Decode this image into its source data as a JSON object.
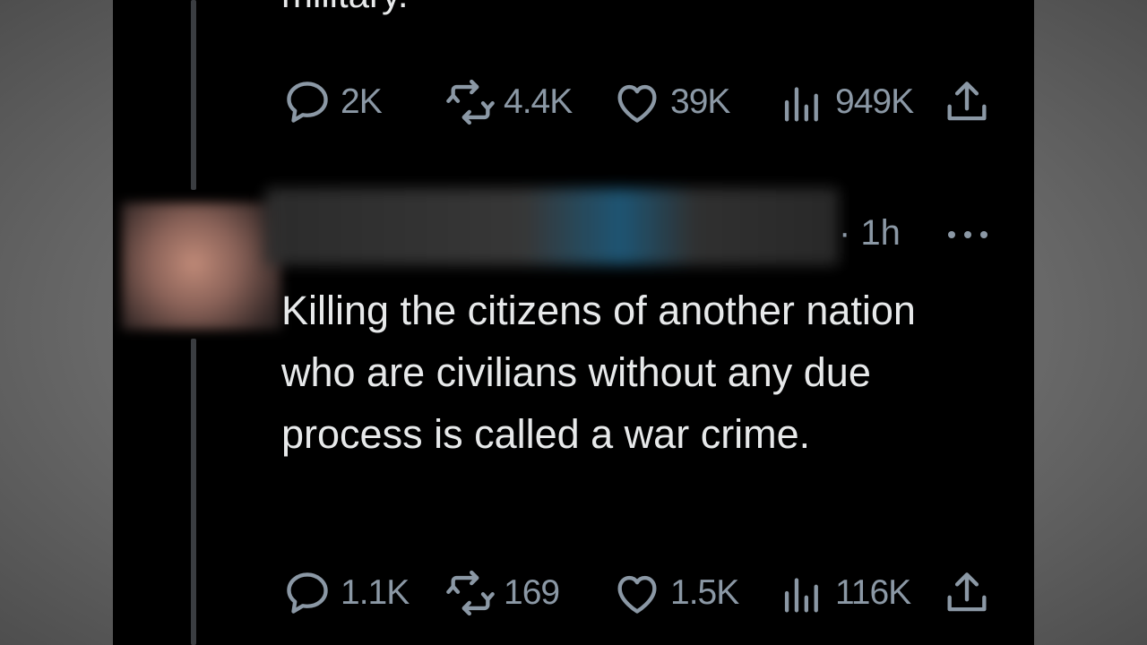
{
  "previous_tweet": {
    "text_fragment": "military.",
    "stats": {
      "replies": "2K",
      "retweets": "4.4K",
      "likes": "39K",
      "views": "949K"
    }
  },
  "reply_tweet": {
    "time": "· 1h",
    "text": "Killing the citizens of another nation who are civilians without any due process is called a war crime.",
    "stats": {
      "replies": "1.1K",
      "retweets": "169",
      "likes": "1.5K",
      "views": "116K"
    }
  },
  "icons": {
    "reply": "speech-bubble-icon",
    "retweet": "retweet-icon",
    "like": "heart-icon",
    "views": "bar-chart-icon",
    "share": "share-icon",
    "more": "more-dots-icon"
  },
  "colors": {
    "background": "#000000",
    "text": "#e7e9ea",
    "muted": "#8b98a5",
    "thread_line": "#3a3d41"
  }
}
